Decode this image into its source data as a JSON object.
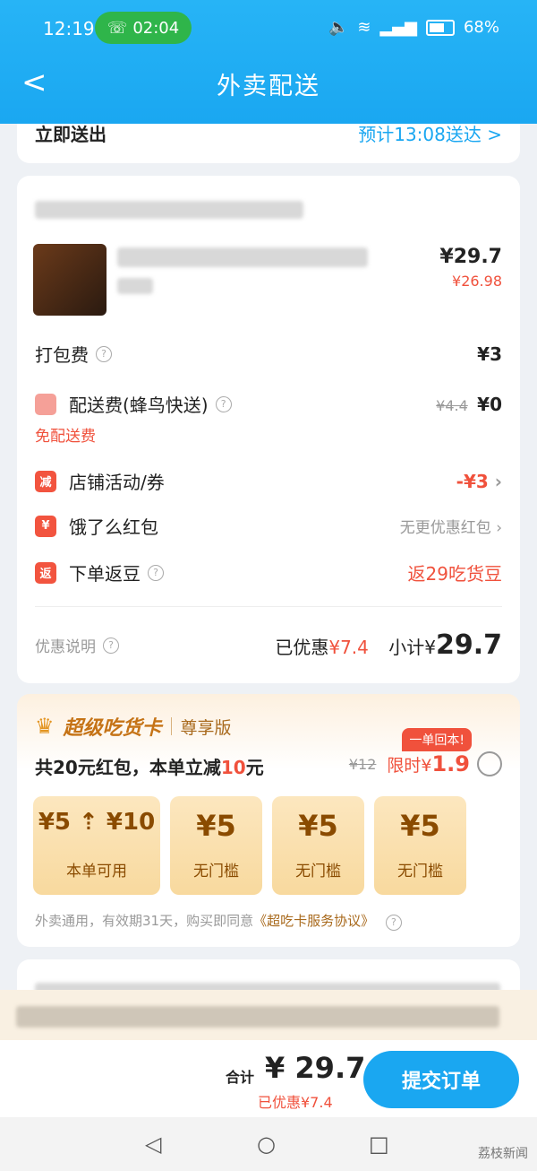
{
  "status_bar": {
    "time": "12:19",
    "call_duration": "02:04",
    "battery": "68%"
  },
  "header": {
    "back": "<",
    "title": "外卖配送"
  },
  "delivery": {
    "mode": "立即送出",
    "eta": "预计13:08送达 >"
  },
  "order": {
    "item_price": "¥29.7",
    "item_sub_price": "¥26.98",
    "rows": {
      "packing_label": "打包费",
      "packing_value": "¥3",
      "delivery_label": "配送费(蜂鸟快送)",
      "delivery_old": "¥4.4",
      "delivery_value": "¥0",
      "delivery_note": "免配送费",
      "shop_label": "店铺活动/券",
      "shop_value": "-¥3",
      "redpack_label": "饿了么红包",
      "redpack_value": "无更优惠红包",
      "return_label": "下单返豆",
      "return_value": "返29吃货豆"
    },
    "badges": {
      "shop": "减",
      "redpack": "¥",
      "return": "返"
    },
    "discount_info": "优惠说明",
    "saved_label": "已优惠",
    "saved_value": "¥7.4",
    "subtotal_label": "小计¥",
    "subtotal_value": "29.7"
  },
  "vip": {
    "brand": "超级吃货卡",
    "edition": "尊享版",
    "offer_prefix": "共20元红包，本单立减",
    "offer_amount": "10",
    "offer_suffix": "元",
    "old_price": "¥12",
    "limited_label": "限时¥",
    "limited_price": "1.9",
    "tag": "一单回本!",
    "coupons": [
      {
        "amount": "¥5 ⇡ ¥10",
        "sub": "本单可用"
      },
      {
        "amount": "¥5",
        "sub": "无门槛"
      },
      {
        "amount": "¥5",
        "sub": "无门槛"
      },
      {
        "amount": "¥5",
        "sub": "无门槛"
      }
    ],
    "footer": "外卖通用，有效期31天，购买即同意",
    "footer_link": "《超吃卡服务协议》"
  },
  "bottom": {
    "total_label": "合计",
    "total_amount": "¥ 29.7",
    "total_saved": "已优惠¥7.4",
    "submit": "提交订单"
  },
  "watermark": "荔枝新闻"
}
